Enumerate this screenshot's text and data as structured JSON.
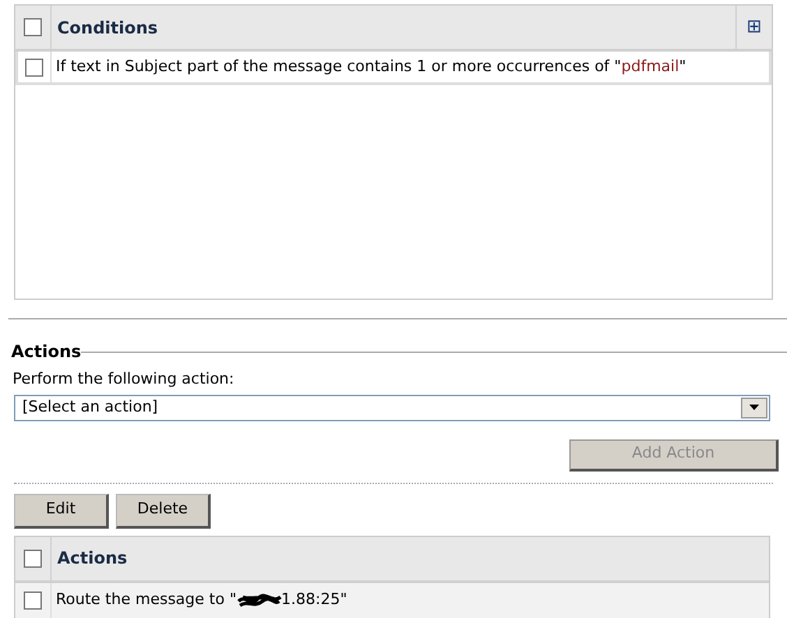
{
  "conditions_table": {
    "header": {
      "checked": false,
      "label": "Conditions",
      "add_icon": "⊞"
    },
    "rows": [
      {
        "checked": false,
        "parts": [
          {
            "text": "If text in Subject part of the message contains 1 or more occurrences of \""
          },
          {
            "text": "pdfmail",
            "kind": "value"
          },
          {
            "text": "\""
          }
        ]
      }
    ]
  },
  "actions_section": {
    "title": "Actions",
    "label": "Perform the following action:",
    "select": {
      "value": "[Select an action]"
    },
    "add_button": {
      "label": "Add Action",
      "disabled": true
    }
  },
  "buttons": [
    "Edit",
    "Delete"
  ],
  "actions_table": {
    "header": {
      "checked": false,
      "label": "Actions"
    },
    "rows": [
      {
        "checked": false,
        "before": "Route the message to \"",
        "redacted": true,
        "after": "1.88:25\""
      }
    ]
  }
}
